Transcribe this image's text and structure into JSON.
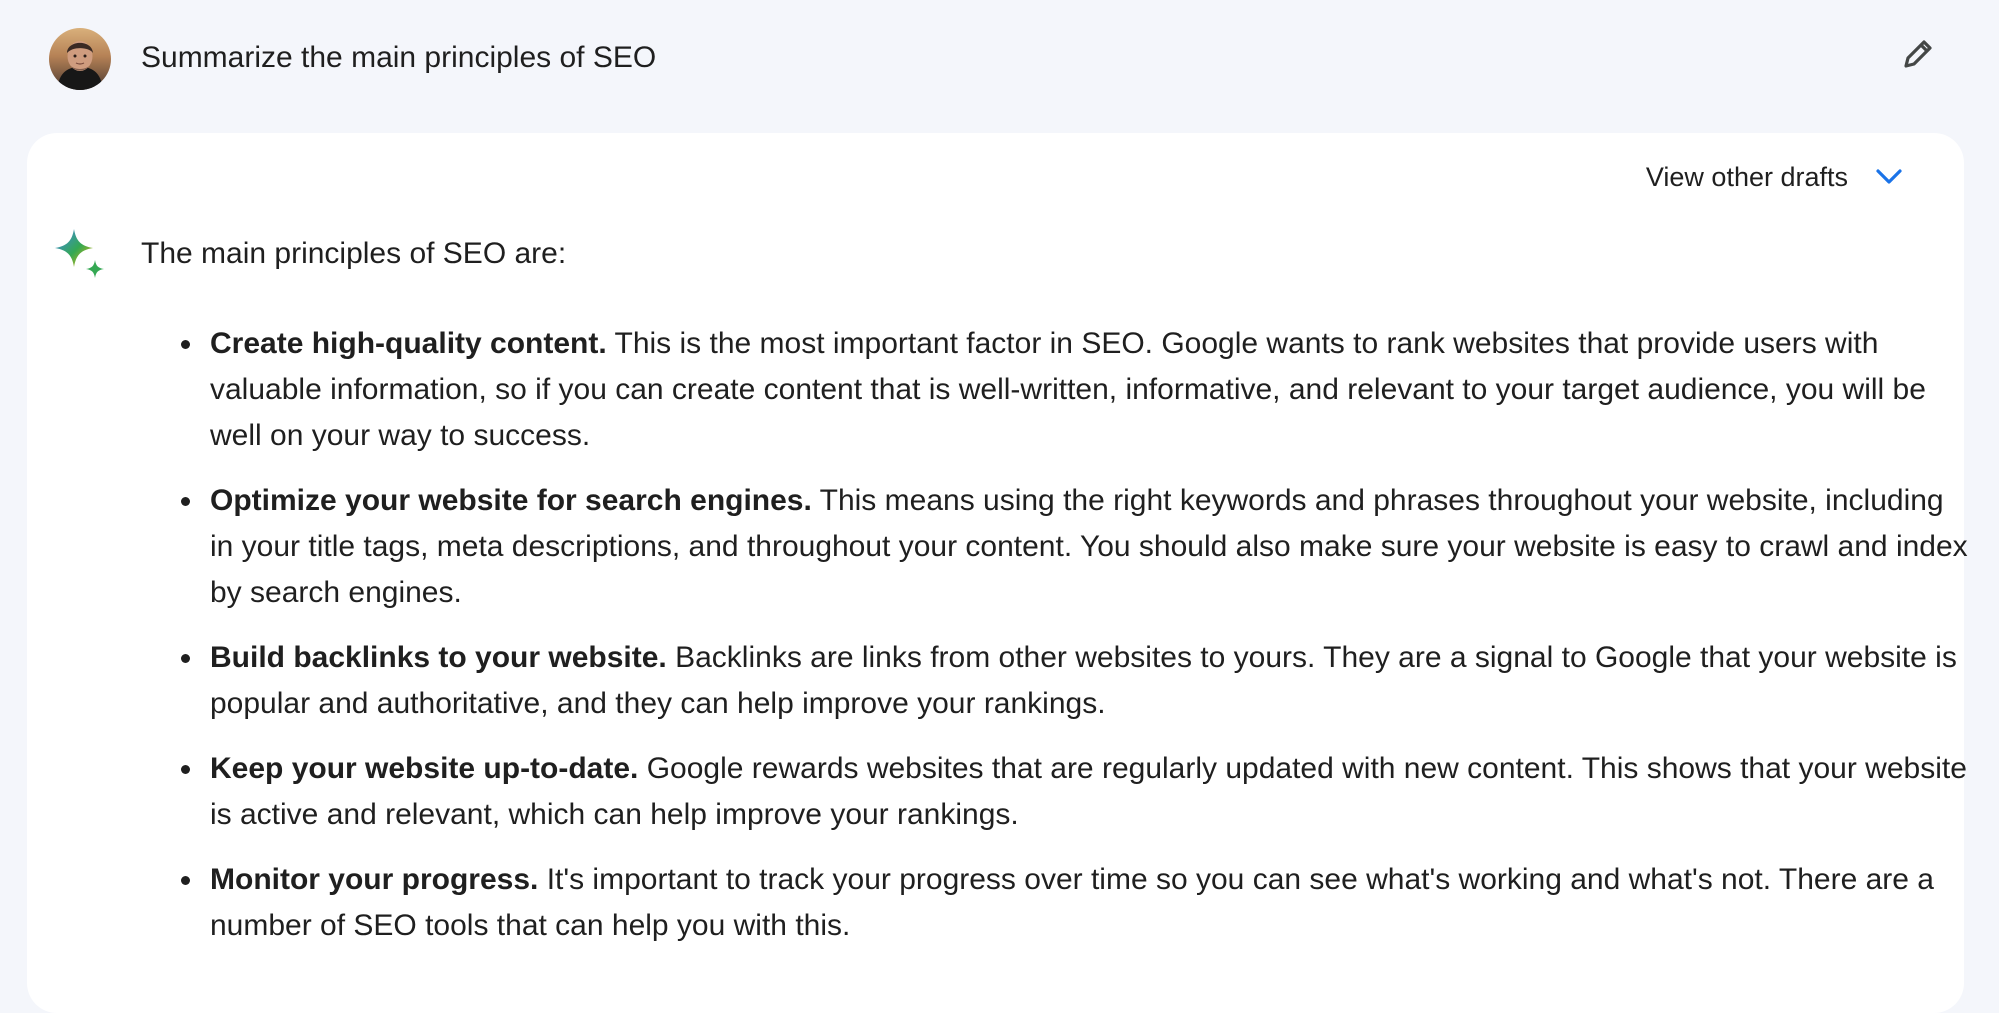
{
  "prompt": {
    "text": "Summarize the main principles of SEO"
  },
  "response": {
    "drafts_label": "View other drafts",
    "intro": "The main principles of SEO are:",
    "bullets": [
      {
        "title": "Create high-quality content.",
        "body": " This is the most important factor in SEO. Google wants to rank websites that provide users with valuable information, so if you can create content that is well-written, informative, and relevant to your target audience, you will be well on your way to success."
      },
      {
        "title": "Optimize your website for search engines.",
        "body": " This means using the right keywords and phrases throughout your website, including in your title tags, meta descriptions, and throughout your content. You should also make sure your website is easy to crawl and index by search engines."
      },
      {
        "title": "Build backlinks to your website.",
        "body": " Backlinks are links from other websites to yours. They are a signal to Google that your website is popular and authoritative, and they can help improve your rankings."
      },
      {
        "title": "Keep your website up-to-date.",
        "body": " Google rewards websites that are regularly updated with new content. This shows that your website is active and relevant, which can help improve your rankings."
      },
      {
        "title": "Monitor your progress.",
        "body": " It's important to track your progress over time so you can see what's working and what's not. There are a number of SEO tools that can help you with this."
      }
    ]
  },
  "icons": {
    "avatar": "user-avatar",
    "edit": "pencil-icon",
    "chevron": "chevron-down-icon",
    "assistant": "sparkle-icon"
  },
  "colors": {
    "page_background": "#f4f6fb",
    "card_background": "#ffffff",
    "text": "#1f1f1f",
    "accent_blue": "#1a73e8"
  }
}
